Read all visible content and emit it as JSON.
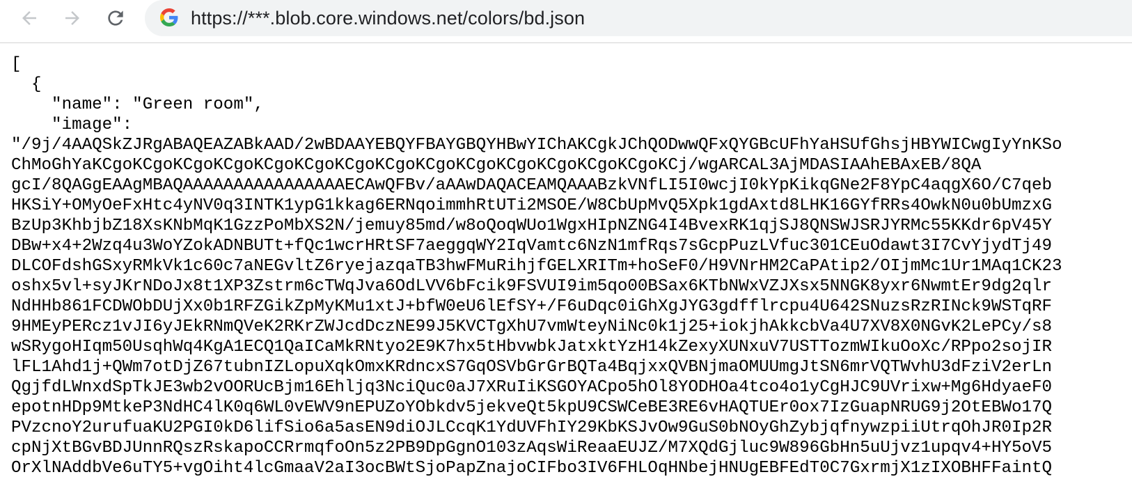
{
  "browser": {
    "url": "https://***.blob.core.windows.net/colors/bd.json"
  },
  "json_lines": [
    "[",
    "  {",
    "    \"name\": \"Green room\",",
    "    \"image\":",
    "\"/9j/4AAQSkZJRgABAQEAZABkAAD/2wBDAAYEBQYFBAYGBQYHBwYIChAKCgkJChQODwwQFxQYGBcUFhYaHSUfGhsjHBYWICwgIyYnKSo",
    "ChMoGhYaKCgoKCgoKCgoKCgoKCgoKCgoKCgoKCgoKCgoKCgoKCgoKCgoKCgoKCgoKCj/wgARCAL3AjMDASIAAhEBAxEB/8QA",
    "gcI/8QAGgEAAgMBAQAAAAAAAAAAAAAAAAECAwQFBv/aAAwDAQACEAMQAAABzkVNfLI5I0wcjI0kYpKikqGNe2F8YpC4aqgX6O/C7qeb",
    "HKSiY+OMyOeFxHtc4yNV0q3INTK1ypG1kkag6ERNqoimmhRtUTi2MSOE/W8CbUpMvQ5Xpk1gdAxtd8LHK16GYfRRs4OwkN0u0bUmzxG",
    "BzUp3KhbjbZ18XsKNbMqK1GzzPoMbXS2N/jemuy85md/w8oQoqWUo1WgxHIpNZNG4I4BvexRK1qjSJ8QNSWJSRJYRMc55KKdr6pV45Y",
    "DBw+x4+2Wzq4u3WoYZokADNBUTt+fQc1wcrHRtSF7aeggqWY2IqVamtc6NzN1mfRqs7sGcpPuzLVfuc301CEuOdawt3I7CvYjydTj49",
    "DLCOFdshGSxyRMkVk1c60c7aNEGvltZ6ryejazqaTB3hwFMuRihjfGELXRITm+hoSeF0/H9VNrHM2CaPAtip2/OIjmMc1Ur1MAq1CK23",
    "oshx5vl+syJKrNDoJx8t1XP3Zstrm6cTWqJva6OdLVV6bFcik9FSVUI9im5qo00BSax6KTbNWxVZJXsx5NNGK8yxr6NwmtEr9dg2qlr",
    "NdHHb861FCDWObDUjXx0b1RFZGikZpMyKMu1xtJ+bfW0eU6lEfSY+/F6uDqc0iGhXgJYG3gdfflrcpu4U642SNuzsRzRINck9WSTqRF",
    "9HMEyPERcz1vJI6yJEkRNmQVeK2RKrZWJcdDczNE99J5KVCTgXhU7vmWteyNiNc0k1j25+iokjhAkkcbVa4U7XV8X0NGvK2LePCy/s8",
    "wSRygoHIqm50UsqhWq4KgA1ECQ1QaICaMkRNtyo2E9K7hx5tHbvwbkJatxktYzH14kZexyXUNxuV7USTTozmWIkuOoXc/RPpo2sojIR",
    "lFL1Ahd1j+QWm7otDjZ67tubnIZLopuXqkOmxKRdncxS7GqOSVbGrGrBQTa4BqjxxQVBNjmaOMUUmgJtSN6mrVQTWvhU3dFziV2erLn",
    "QgjfdLWnxdSpTkJE3wb2vOORUcBjm16Ehljq3NciQuc0aJ7XRuIiKSGOYACpo5hOl8YODHOa4tco4o1yCgHJC9UVrixw+Mg6HdyaeF0",
    "epotnHDp9MtkeP3NdHC4lK0q6WL0vEWV9nEPUZoYObkdv5jekveQt5kpU9CSWCeBE3RE6vHAQTUEr0ox7IzGuapNRUG9j2OtEBWo17Q",
    "PVzcnoY2urufuaKU2PGI0kD6lifSio6a5asEN9diOJLCcqK1YdUVFhIY29KbKSJvOw9GuS0bNOyGhZybjqfnywzpiiUtrqOhJR0Ip2R",
    "cpNjXtBGvBDJUnnRQszRskapoCCRrmqfoOn5z2PB9DpGgnO103zAqsWiReaaEUJZ/M7XQdGjluc9W896GbHn5uUjvz1upqv4+HY5oV5",
    "OrXlNAddbVe6uTY5+vgOiht4lcGmaaV2aI3ocBWtSjoPapZnajoCIFbo3IV6FHLOqHNbejHNUgEBFEdT0C7GxrmjX1zIXOBHFFaintQ"
  ]
}
